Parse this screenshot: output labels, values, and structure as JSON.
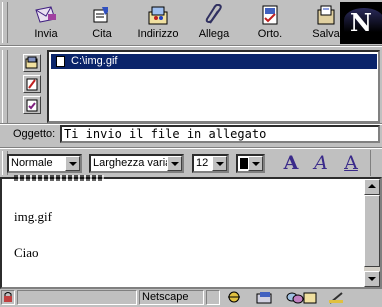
{
  "toolbar": {
    "buttons": [
      {
        "label": "Invia",
        "icon": "send-icon"
      },
      {
        "label": "Cita",
        "icon": "quote-icon"
      },
      {
        "label": "Indirizzo",
        "icon": "address-book-icon"
      },
      {
        "label": "Allega",
        "icon": "attach-icon"
      },
      {
        "label": "Orto.",
        "icon": "spelling-icon"
      },
      {
        "label": "Salva",
        "icon": "save-icon"
      }
    ],
    "logo": "N"
  },
  "address": {
    "attachment": "C:\\img.gif"
  },
  "subject": {
    "label": "Oggetto:",
    "value": "Ti invio il file in allegato"
  },
  "format": {
    "paragraph_style": "Normale",
    "font": "Larghezza varia",
    "size": "12",
    "colors": {
      "text": "#000000",
      "accent": "#3a2a8a"
    },
    "buttons": [
      "A",
      "A",
      "A"
    ]
  },
  "body": {
    "lines": [
      "img.gif",
      "Ciao"
    ]
  },
  "status": {
    "text": "Netscape"
  }
}
